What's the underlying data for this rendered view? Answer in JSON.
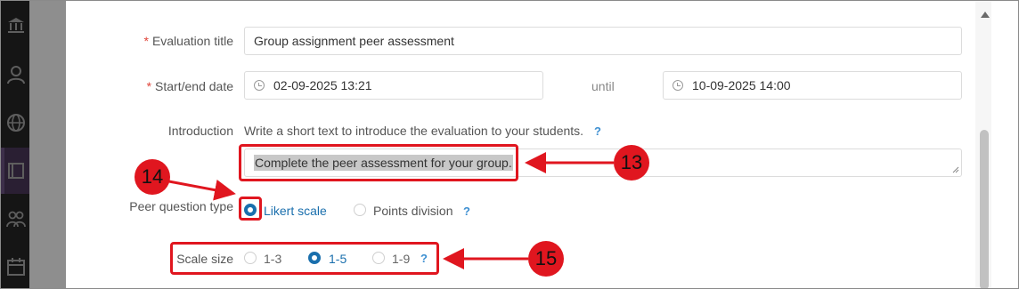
{
  "form": {
    "title_label": "Evaluation title",
    "title_value": "Group assignment peer assessment",
    "date_label": "Start/end date",
    "start_value": "02-09-2025 13:21",
    "until_label": "until",
    "end_value": "10-09-2025 14:00",
    "intro_label": "Introduction",
    "intro_hint": "Write a short text to introduce the evaluation to your students.",
    "help_mark": "?",
    "intro_text": "Complete the peer assessment for your group.",
    "question_type_label": "Peer question type",
    "question_types": [
      {
        "label": "Likert scale",
        "selected": true
      },
      {
        "label": "Points division",
        "selected": false
      }
    ],
    "scale_label": "Scale size",
    "scale_options": [
      {
        "label": "1-3",
        "selected": false
      },
      {
        "label": "1-5",
        "selected": true
      },
      {
        "label": "1-9",
        "selected": false
      }
    ],
    "required_mark": "*"
  },
  "callouts": {
    "c13": "13",
    "c14": "14",
    "c15": "15"
  },
  "colors": {
    "accent": "#1a6fad",
    "callout": "#e0161f",
    "required": "#e0453a",
    "help": "#3d8fd1"
  }
}
